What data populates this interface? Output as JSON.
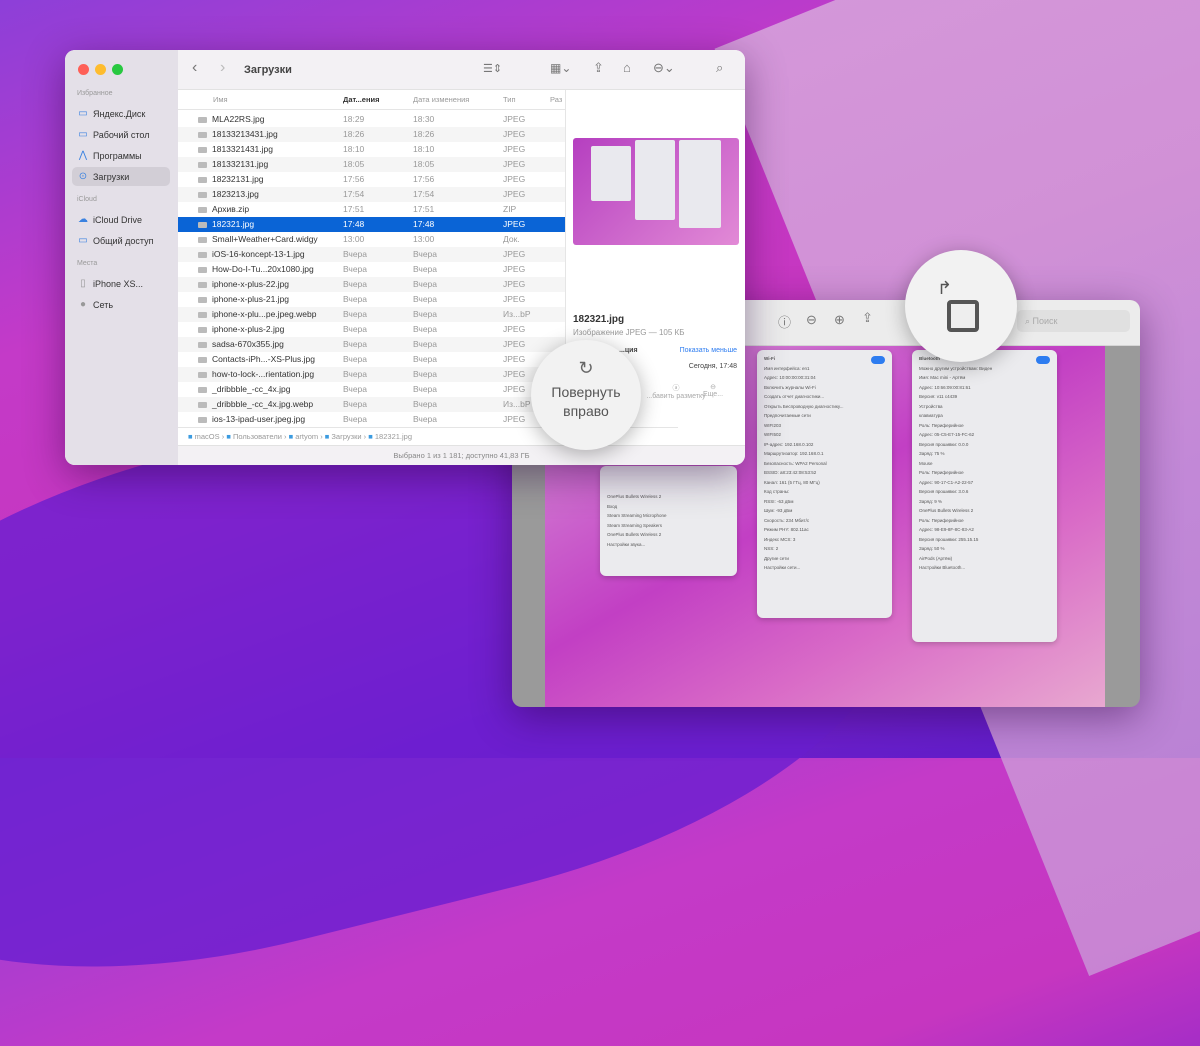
{
  "finder": {
    "title": "Загрузки",
    "sidebar": {
      "sections": [
        {
          "label": "Избранное",
          "items": [
            {
              "label": "Яндекс.Диск",
              "icon": "folder-icon"
            },
            {
              "label": "Рабочий стол",
              "icon": "desktop-icon"
            },
            {
              "label": "Программы",
              "icon": "apps-icon"
            },
            {
              "label": "Загрузки",
              "icon": "downloads-icon",
              "selected": true
            }
          ]
        },
        {
          "label": "iCloud",
          "items": [
            {
              "label": "iCloud Drive",
              "icon": "cloud-icon"
            },
            {
              "label": "Общий доступ",
              "icon": "shared-folder-icon"
            }
          ]
        },
        {
          "label": "Места",
          "items": [
            {
              "label": "iPhone XS...",
              "icon": "phone-icon"
            },
            {
              "label": "Сеть",
              "icon": "network-icon"
            }
          ]
        }
      ]
    },
    "columns": [
      "Имя",
      "Дат...ения",
      "Дата изменения",
      "Тип",
      "Раз"
    ],
    "files": [
      [
        "MLA22RS.jpg",
        "18:29",
        "18:30",
        "JPEG"
      ],
      [
        "18133213431.jpg",
        "18:26",
        "18:26",
        "JPEG"
      ],
      [
        "1813321431.jpg",
        "18:10",
        "18:10",
        "JPEG"
      ],
      [
        "181332131.jpg",
        "18:05",
        "18:05",
        "JPEG"
      ],
      [
        "18232131.jpg",
        "17:56",
        "17:56",
        "JPEG"
      ],
      [
        "1823213.jpg",
        "17:54",
        "17:54",
        "JPEG"
      ],
      [
        "Архив.zip",
        "17:51",
        "17:51",
        "ZIP"
      ],
      [
        "182321.jpg",
        "17:48",
        "17:48",
        "JPEG"
      ],
      [
        "Small+Weather+Card.widgy",
        "13:00",
        "13:00",
        "Док."
      ],
      [
        "iOS-16-koncept-13-1.jpg",
        "Вчера",
        "Вчера",
        "JPEG"
      ],
      [
        "How-Do-I-Tu...20x1080.jpg",
        "Вчера",
        "Вчера",
        "JPEG"
      ],
      [
        "iphone-x-plus-22.jpg",
        "Вчера",
        "Вчера",
        "JPEG"
      ],
      [
        "iphone-x-plus-21.jpg",
        "Вчера",
        "Вчера",
        "JPEG"
      ],
      [
        "iphone-x-plu...pe.jpeg.webp",
        "Вчера",
        "Вчера",
        "Из...bP"
      ],
      [
        "iphone-x-plus-2.jpg",
        "Вчера",
        "Вчера",
        "JPEG"
      ],
      [
        "sadsa-670x355.jpg",
        "Вчера",
        "Вчера",
        "JPEG"
      ],
      [
        "Contacts-iPh...-XS-Plus.jpg",
        "Вчера",
        "Вчера",
        "JPEG"
      ],
      [
        "how-to-lock-...rientation.jpg",
        "Вчера",
        "Вчера",
        "JPEG"
      ],
      [
        "_dribbble_-cc_4x.jpg",
        "Вчера",
        "Вчера",
        "JPEG"
      ],
      [
        "_dribbble_-cc_4x.jpg.webp",
        "Вчера",
        "Вчера",
        "Из...bP"
      ],
      [
        "ios-13-ipad-user.jpeg.jpg",
        "Вчера",
        "Вчера",
        "JPEG"
      ]
    ],
    "selected_index": 7,
    "path": [
      "macOS",
      "Пользователи",
      "artyom",
      "Загрузки",
      "182321.jpg"
    ],
    "status": "Выбрано 1 из 1 181; доступно 41,83 ГБ",
    "preview": {
      "name": "182321.jpg",
      "kind": "Изображение JPEG — 105 КБ",
      "info_label": "...ция",
      "show_less": "Показать меньше",
      "date": "Сегодня, 17:48",
      "actions": [
        "...бавить разметку",
        "Еще..."
      ]
    }
  },
  "magnifier_left": {
    "label_line1": "Повернуть",
    "label_line2": "вправо",
    "icon": "rotate-right-icon"
  },
  "magnifier_right": {
    "icon": "rotate-right-icon"
  },
  "preview_app": {
    "search_placeholder": "Поиск",
    "panels": [
      [
        "OnePlus Bullets Wireless 2",
        "Вход",
        "Steam Streaming Microphone",
        "Steam Streaming Speakers",
        "OnePlus Bullets Wireless 2",
        "Настройки звука..."
      ],
      [
        "Wi-Fi",
        "Имя интерфейса: en1",
        "Адрес: 10:00:00:00:31:04",
        "Включить журналы Wi-Fi",
        "Создать отчет диагностики...",
        "Открыть Беспроводную диагностику...",
        "Предпочитаемые сети",
        "WIFI203",
        "WIFI502",
        "IP-адрес: 192.168.0.102",
        "Маршрутизатор: 192.168.0.1",
        "Безопасность: WPA2 Personal",
        "BSSID: a8:23:42:08:53:52",
        "Канал: 161 (5 ГГц, 80 МГц)",
        "Код страны:",
        "RSSI: -63 дБм",
        "Шум: -93 дБм",
        "Скорость: 234 Мбит/с",
        "Режим PHY: 802.11ac",
        "Индекс MCS: 3",
        "NSS: 2",
        "Другие сети",
        "Настройки сети..."
      ],
      [
        "Bluetooth",
        "Можно другим устройствам: Виден",
        "Имя: Mac mini - Артём",
        "Адрес: 10:66:09:00:81:61",
        "Версия: v11 c4439",
        "Устройства",
        "клавиатура",
        "Роль: Периферийное",
        "Адрес: 05-C5-E7-15-FC-62",
        "Версия прошивки: 0.0.0",
        "Заряд: 75 %",
        "Mouse",
        "Роль: Периферийное",
        "Адрес: 90-17-C1-A2-22-57",
        "Версия прошивки: 3.0.6",
        "Заряд: 9 %",
        "OnePlus Bullets Wireless 2",
        "Роль: Периферийное",
        "Адрес: 98-E9-8F-8C-83-A2",
        "Версия прошивки: 255.15.15",
        "Заряд: 50 %",
        "AirPods (Артём)",
        "Настройки Bluetooth..."
      ]
    ]
  },
  "colors": {
    "selection": "#0a64d6",
    "accent": "#2d7cf0",
    "close": "#fe5f57",
    "minimize": "#febc2e",
    "zoom": "#28c840"
  }
}
